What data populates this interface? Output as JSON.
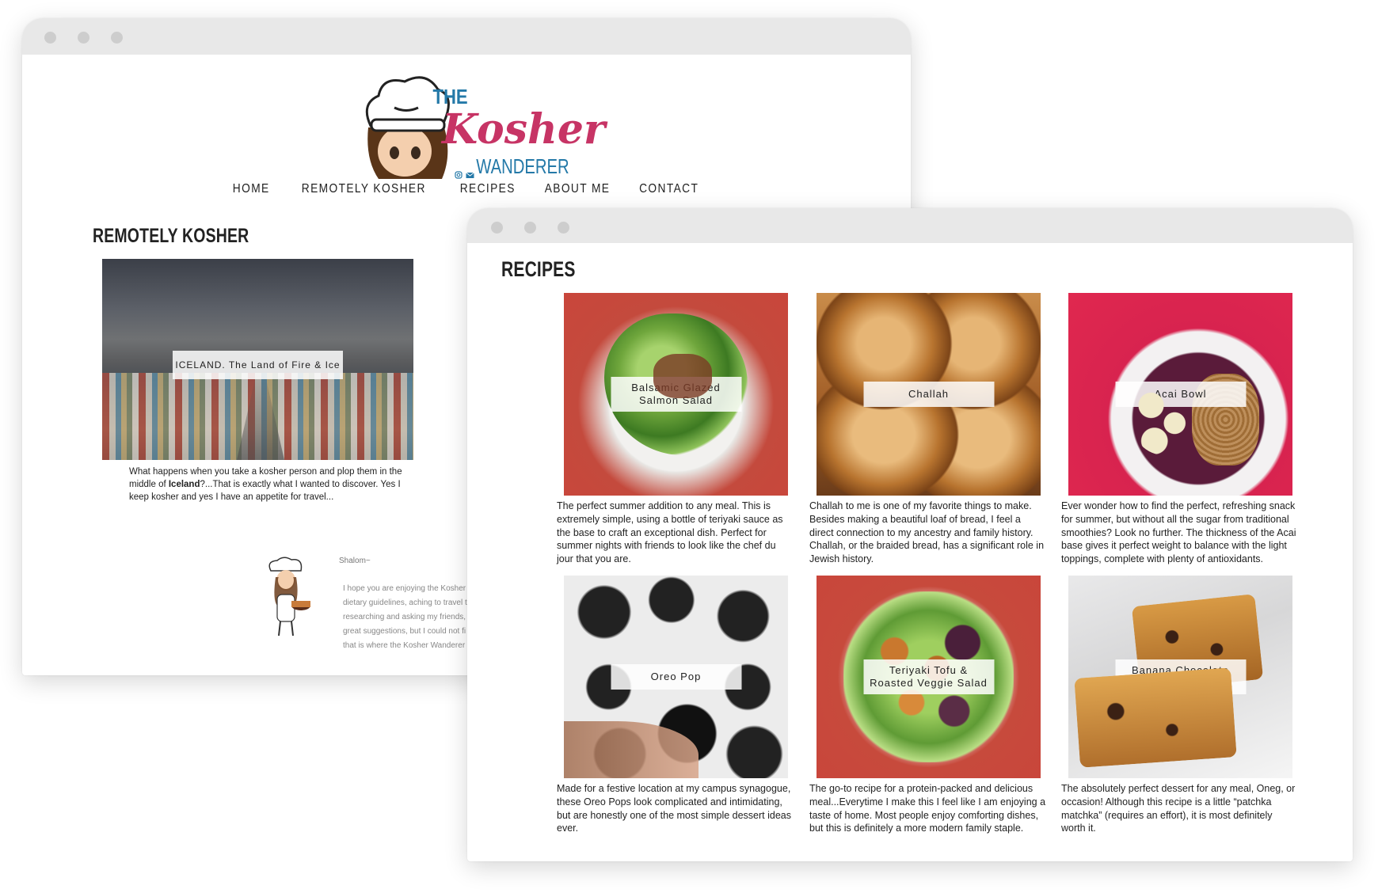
{
  "colors": {
    "brand_pink": "#c73465",
    "brand_blue": "#2479a8",
    "window_bar": "#e8e8e8"
  },
  "back_window": {
    "logo": {
      "the": "THE",
      "kosher": "Kosher",
      "wanderer": "WANDERER"
    },
    "social_icons": [
      "instagram-icon",
      "email-icon"
    ],
    "nav": [
      "HOME",
      "REMOTELY KOSHER",
      "RECIPES",
      "ABOUT ME",
      "CONTACT"
    ],
    "section_title": "REMOTELY KOSHER",
    "feature_label": "ICELAND. The Land of Fire & Ice",
    "feature_text_1": "What happens when you take a kosher person and plop them in the middle of ",
    "feature_text_bold": "Iceland",
    "feature_text_2": "?...That is exactly what I wanted to discover. Yes I keep kosher and yes I have an appetite for travel...",
    "shalom": "Shalom~",
    "shalom_lines": [
      "I hope you are enjoying the Kosher",
      "dietary guidelines, aching to travel t",
      "researching and asking my friends,",
      "great suggestions, but I could not fi",
      "that is where the Kosher Wanderer"
    ]
  },
  "front_window": {
    "section_title": "RECIPES",
    "recipes": [
      {
        "label": "Balsamic Glazed Salmon Salad",
        "text": "The perfect summer addition to any meal. This is extremely simple, using a bottle of teriyaki sauce as the base to craft an exceptional dish. Perfect for summer nights with friends to look like the chef du jour that you are."
      },
      {
        "label": "Challah",
        "text": "Challah to me is one of my favorite things to make. Besides making a beautiful loaf of bread, I feel a direct connection to my ancestry and family history. Challah, or the braided bread, has a significant role in Jewish history."
      },
      {
        "label": "Acai Bowl",
        "text": "Ever wonder how to find the perfect, refreshing snack for summer, but without all the sugar from traditional smoothies? Look no further. The thickness of the Acai base gives it perfect weight to balance with the light toppings, complete with plenty of antioxidants."
      },
      {
        "label": "Oreo Pop",
        "text": "Made for a festive location at my campus synagogue, these Oreo Pops look complicated and intimidating, but are honestly one of the most simple dessert ideas ever."
      },
      {
        "label": "Teriyaki Tofu & Roasted Veggie Salad",
        "text": "The go-to recipe for a protein-packed and delicious meal...Everytime I make this I feel like I am enjoying a taste of home. Most people enjoy comforting dishes, but this is definitely a more modern family staple."
      },
      {
        "label": "Banana Chocolate Chip Cake",
        "text": "The absolutely perfect dessert for any meal, Oneg, or occasion! Although this recipe is a little “patchka matchka” (requires an effort), it is most definitely worth it."
      }
    ]
  }
}
